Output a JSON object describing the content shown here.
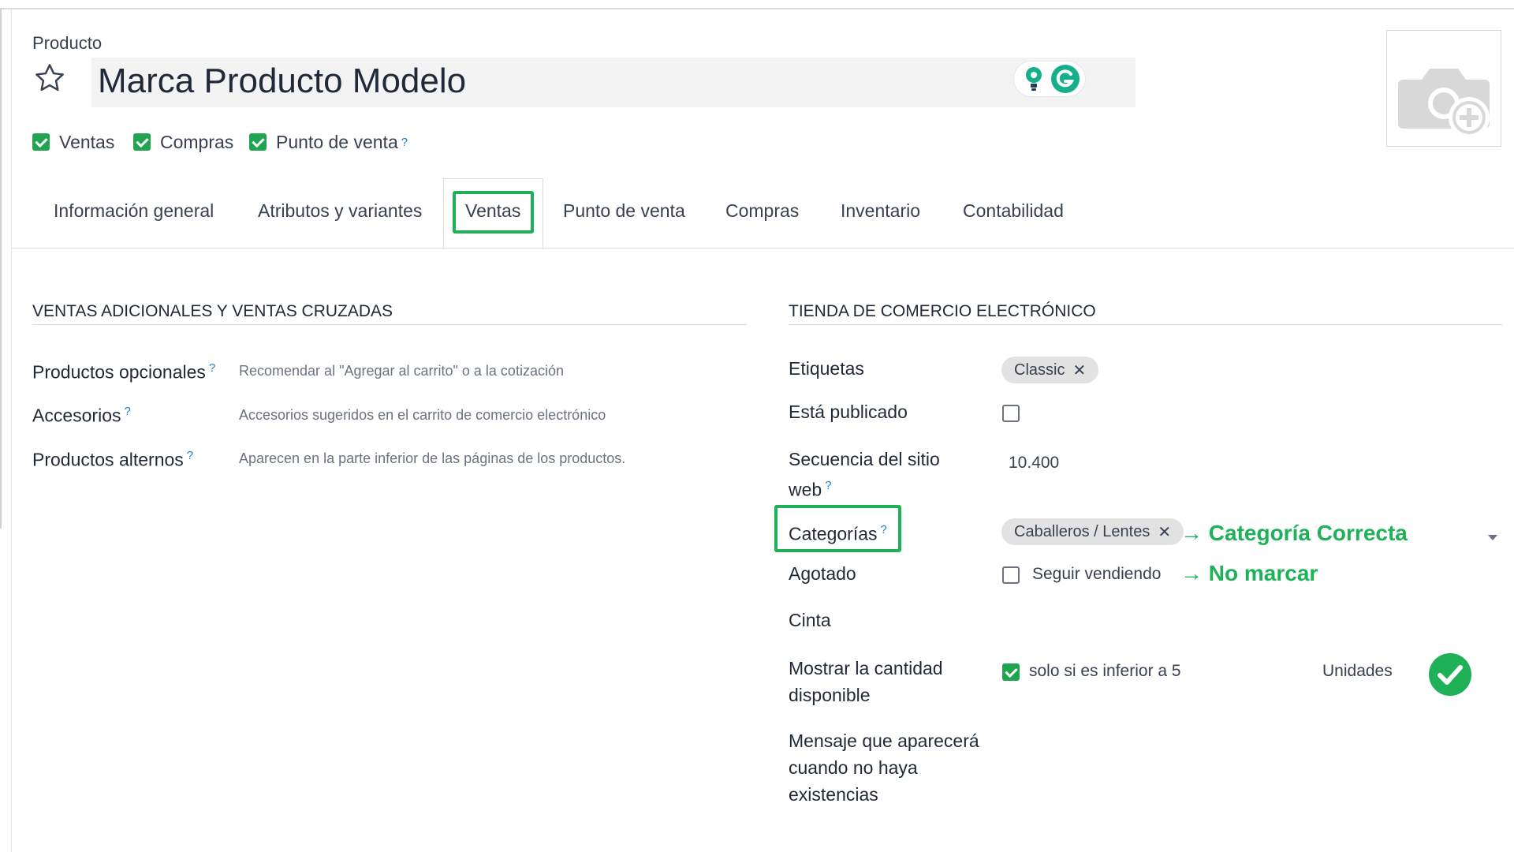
{
  "header": {
    "model_label": "Producto",
    "product_name": "Marca Producto Modelo"
  },
  "options": [
    {
      "label": "Ventas",
      "checked": true
    },
    {
      "label": "Compras",
      "checked": true
    },
    {
      "label": "Punto de venta",
      "checked": true,
      "help": "?"
    }
  ],
  "tabs": [
    {
      "label": "Información general"
    },
    {
      "label": "Atributos y variantes"
    },
    {
      "label": "Ventas",
      "active": true
    },
    {
      "label": "Punto de venta"
    },
    {
      "label": "Compras"
    },
    {
      "label": "Inventario"
    },
    {
      "label": "Contabilidad"
    }
  ],
  "upsell": {
    "title": "VENTAS ADICIONALES Y VENTAS CRUZADAS",
    "fields": [
      {
        "label": "Productos opcionales",
        "help": "?",
        "placeholder": "Recomendar al \"Agregar al carrito\" o a la cotización"
      },
      {
        "label": "Accesorios",
        "help": "?",
        "placeholder": "Accesorios sugeridos en el carrito de comercio electrónico"
      },
      {
        "label": "Productos alternos",
        "help": "?",
        "placeholder": "Aparecen en la parte inferior de las páginas de los productos."
      }
    ]
  },
  "ecommerce": {
    "title": "TIENDA DE COMERCIO ELECTRÓNICO",
    "etiquetas_label": "Etiquetas",
    "etiquetas_tag": "Classic",
    "publicado_label": "Está publicado",
    "publicado_checked": false,
    "secuencia_label_1": "Secuencia del sitio",
    "secuencia_label_2": "web",
    "secuencia_help": "?",
    "secuencia_value": "10.400",
    "categorias_label": "Categorías",
    "categorias_help": "?",
    "categorias_tag": "Caballeros / Lentes",
    "agotado_label": "Agotado",
    "agotado_option": "Seguir vendiendo",
    "agotado_checked": false,
    "cinta_label": "Cinta",
    "mostrar_label_1": "Mostrar la cantidad",
    "mostrar_label_2": "disponible",
    "mostrar_checked": true,
    "mostrar_option": "solo si es inferior a 5",
    "mostrar_unit": "Unidades",
    "mensaje_label_1": "Mensaje que aparecerá",
    "mensaje_label_2": "cuando no haya",
    "mensaje_label_3": "existencias"
  },
  "annotations": {
    "categoria": "→ Categoría Correcta",
    "agotado": "→ No marcar"
  },
  "colors": {
    "accent_green": "#1fb158",
    "checkbox_green": "#1fa44f",
    "help_blue": "#1a7fd1"
  }
}
